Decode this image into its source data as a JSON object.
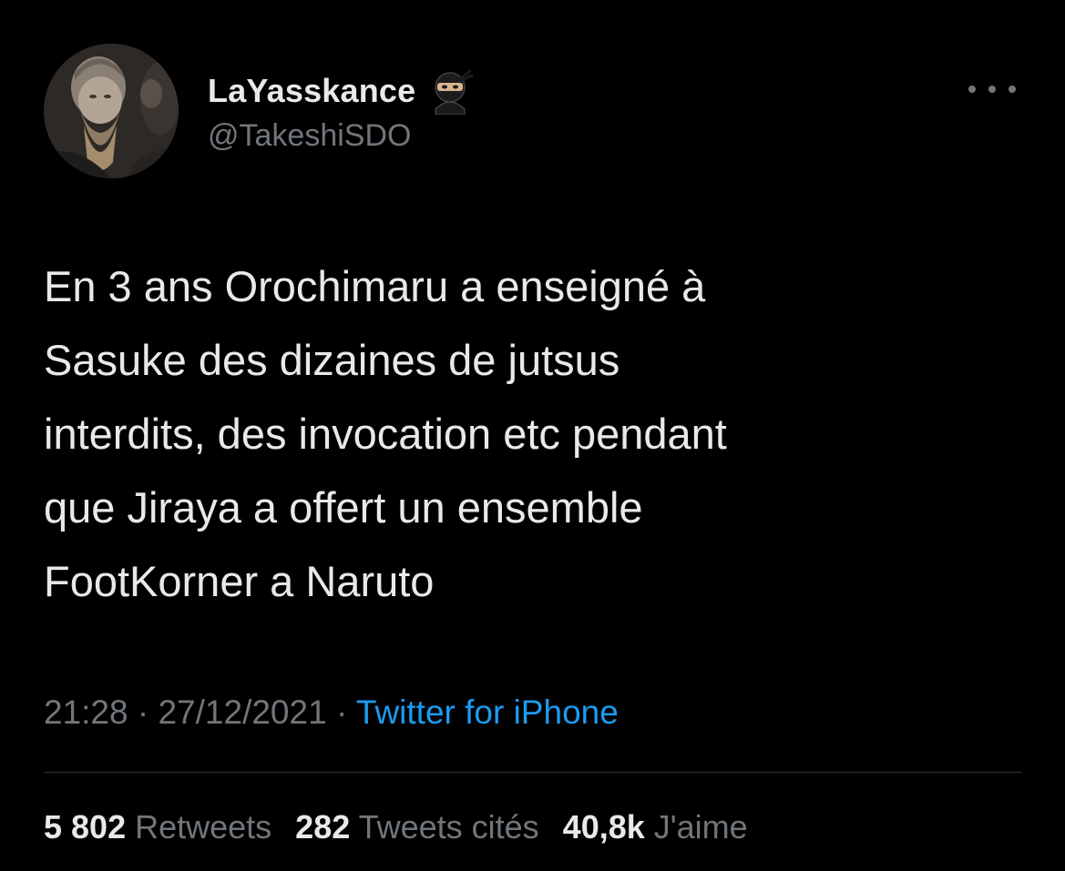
{
  "user": {
    "display_name": "LaYasskance",
    "emoji_icon": "ninja-icon",
    "handle": "@TakeshiSDO"
  },
  "tweet": {
    "lines": [
      "En 3 ans Orochimaru a enseigné à",
      "Sasuke des dizaines de jutsus",
      "interdits, des invocation etc pendant",
      "que Jiraya a offert un ensemble",
      "FootKorner a Naruto"
    ]
  },
  "meta": {
    "time": "21:28",
    "separator": " · ",
    "date": "27/12/2021",
    "source": "Twitter for iPhone"
  },
  "stats": {
    "retweets_count": "5 802",
    "retweets_label": " Retweets",
    "quotes_count": "282",
    "quotes_label": " Tweets cités",
    "likes_count": "40,8k",
    "likes_label": " J'aime"
  },
  "colors": {
    "background": "#000000",
    "text": "#e7e9ea",
    "secondary": "#71767b",
    "link": "#1d9bf0",
    "divider": "#2f3336"
  }
}
